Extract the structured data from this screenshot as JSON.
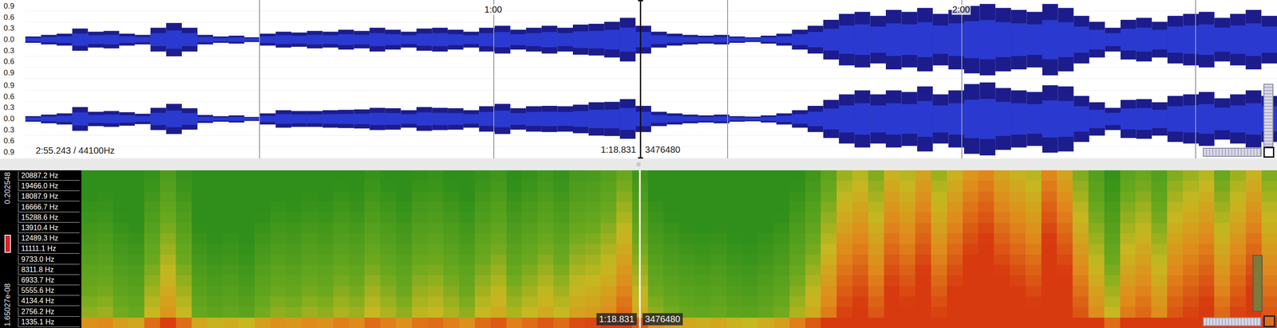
{
  "waveform": {
    "length_label": "2:55.243 / 44100Hz",
    "view_start_s": 0,
    "view_end_s": 160.5,
    "time_ticks": [
      {
        "t": 60,
        "label": "1:00"
      },
      {
        "t": 120,
        "label": "2:00"
      }
    ],
    "gridlines_s": [
      30,
      60,
      90,
      120,
      150
    ],
    "channels": [
      {
        "axis_labels": [
          "0.9",
          "0.6",
          "0.3",
          "0.0",
          "0.3",
          "0.6",
          "0.9"
        ],
        "envelope": [
          0.08,
          0.12,
          0.15,
          0.28,
          0.2,
          0.22,
          0.15,
          0.12,
          0.3,
          0.42,
          0.3,
          0.12,
          0.08,
          0.1,
          0.06,
          0.15,
          0.2,
          0.18,
          0.22,
          0.2,
          0.25,
          0.22,
          0.3,
          0.25,
          0.2,
          0.28,
          0.3,
          0.25,
          0.2,
          0.3,
          0.35,
          0.25,
          0.3,
          0.35,
          0.3,
          0.38,
          0.4,
          0.45,
          0.55,
          0.35,
          0.2,
          0.15,
          0.12,
          0.1,
          0.12,
          0.08,
          0.06,
          0.1,
          0.15,
          0.25,
          0.35,
          0.5,
          0.65,
          0.7,
          0.6,
          0.75,
          0.7,
          0.8,
          0.65,
          0.75,
          0.85,
          0.9,
          0.8,
          0.75,
          0.7,
          0.9,
          0.8,
          0.6,
          0.45,
          0.3,
          0.5,
          0.55,
          0.45,
          0.6,
          0.65,
          0.7,
          0.55,
          0.65,
          0.75,
          0.6
        ]
      },
      {
        "axis_labels": [
          "0.9",
          "0.6",
          "0.3",
          "0.0",
          "0.3",
          "0.6",
          "0.9"
        ],
        "envelope": [
          0.07,
          0.11,
          0.14,
          0.3,
          0.18,
          0.2,
          0.17,
          0.13,
          0.28,
          0.38,
          0.27,
          0.1,
          0.07,
          0.09,
          0.05,
          0.14,
          0.22,
          0.2,
          0.2,
          0.22,
          0.23,
          0.24,
          0.28,
          0.27,
          0.22,
          0.3,
          0.28,
          0.27,
          0.22,
          0.32,
          0.38,
          0.27,
          0.32,
          0.33,
          0.32,
          0.36,
          0.42,
          0.43,
          0.5,
          0.33,
          0.18,
          0.14,
          0.11,
          0.09,
          0.11,
          0.07,
          0.06,
          0.09,
          0.14,
          0.22,
          0.33,
          0.48,
          0.62,
          0.72,
          0.62,
          0.72,
          0.68,
          0.82,
          0.62,
          0.72,
          0.88,
          0.92,
          0.78,
          0.72,
          0.68,
          0.85,
          0.82,
          0.58,
          0.42,
          0.28,
          0.48,
          0.5,
          0.42,
          0.58,
          0.62,
          0.68,
          0.52,
          0.62,
          0.72,
          0.58
        ]
      }
    ]
  },
  "cursor": {
    "time": "1:18.831",
    "sample": "3476480",
    "t": 78.831
  },
  "spectrogram": {
    "scale_max": "0.202548",
    "scale_min": "1.65027e-08",
    "freq_labels": [
      "20887.2 Hz",
      "19466.0 Hz",
      "18087.9 Hz",
      "16666.7 Hz",
      "15288.6 Hz",
      "13910.4 Hz",
      "12489.3 Hz",
      "11111.1 Hz",
      "9733.0 Hz",
      "8311.8 Hz",
      "6933.7 Hz",
      "5555.6 Hz",
      "4134.4 Hz",
      "2756.2 Hz",
      "1335.1 Hz"
    ],
    "start_s": 7.3,
    "end_s": 160.5,
    "columns": [
      0.2,
      0.22,
      0.15,
      0.12,
      0.3,
      0.42,
      0.3,
      0.12,
      0.08,
      0.1,
      0.06,
      0.15,
      0.2,
      0.18,
      0.22,
      0.2,
      0.25,
      0.22,
      0.3,
      0.25,
      0.2,
      0.28,
      0.3,
      0.25,
      0.2,
      0.3,
      0.35,
      0.25,
      0.3,
      0.35,
      0.3,
      0.38,
      0.4,
      0.45,
      0.55,
      0.35,
      0.2,
      0.15,
      0.12,
      0.1,
      0.12,
      0.08,
      0.06,
      0.1,
      0.15,
      0.25,
      0.35,
      0.5,
      0.65,
      0.7,
      0.6,
      0.75,
      0.7,
      0.8,
      0.65,
      0.75,
      0.85,
      0.9,
      0.8,
      0.75,
      0.7,
      0.9,
      0.8,
      0.6,
      0.45,
      0.3,
      0.5,
      0.55,
      0.45,
      0.6,
      0.65,
      0.7,
      0.55,
      0.65,
      0.75,
      0.6
    ]
  }
}
